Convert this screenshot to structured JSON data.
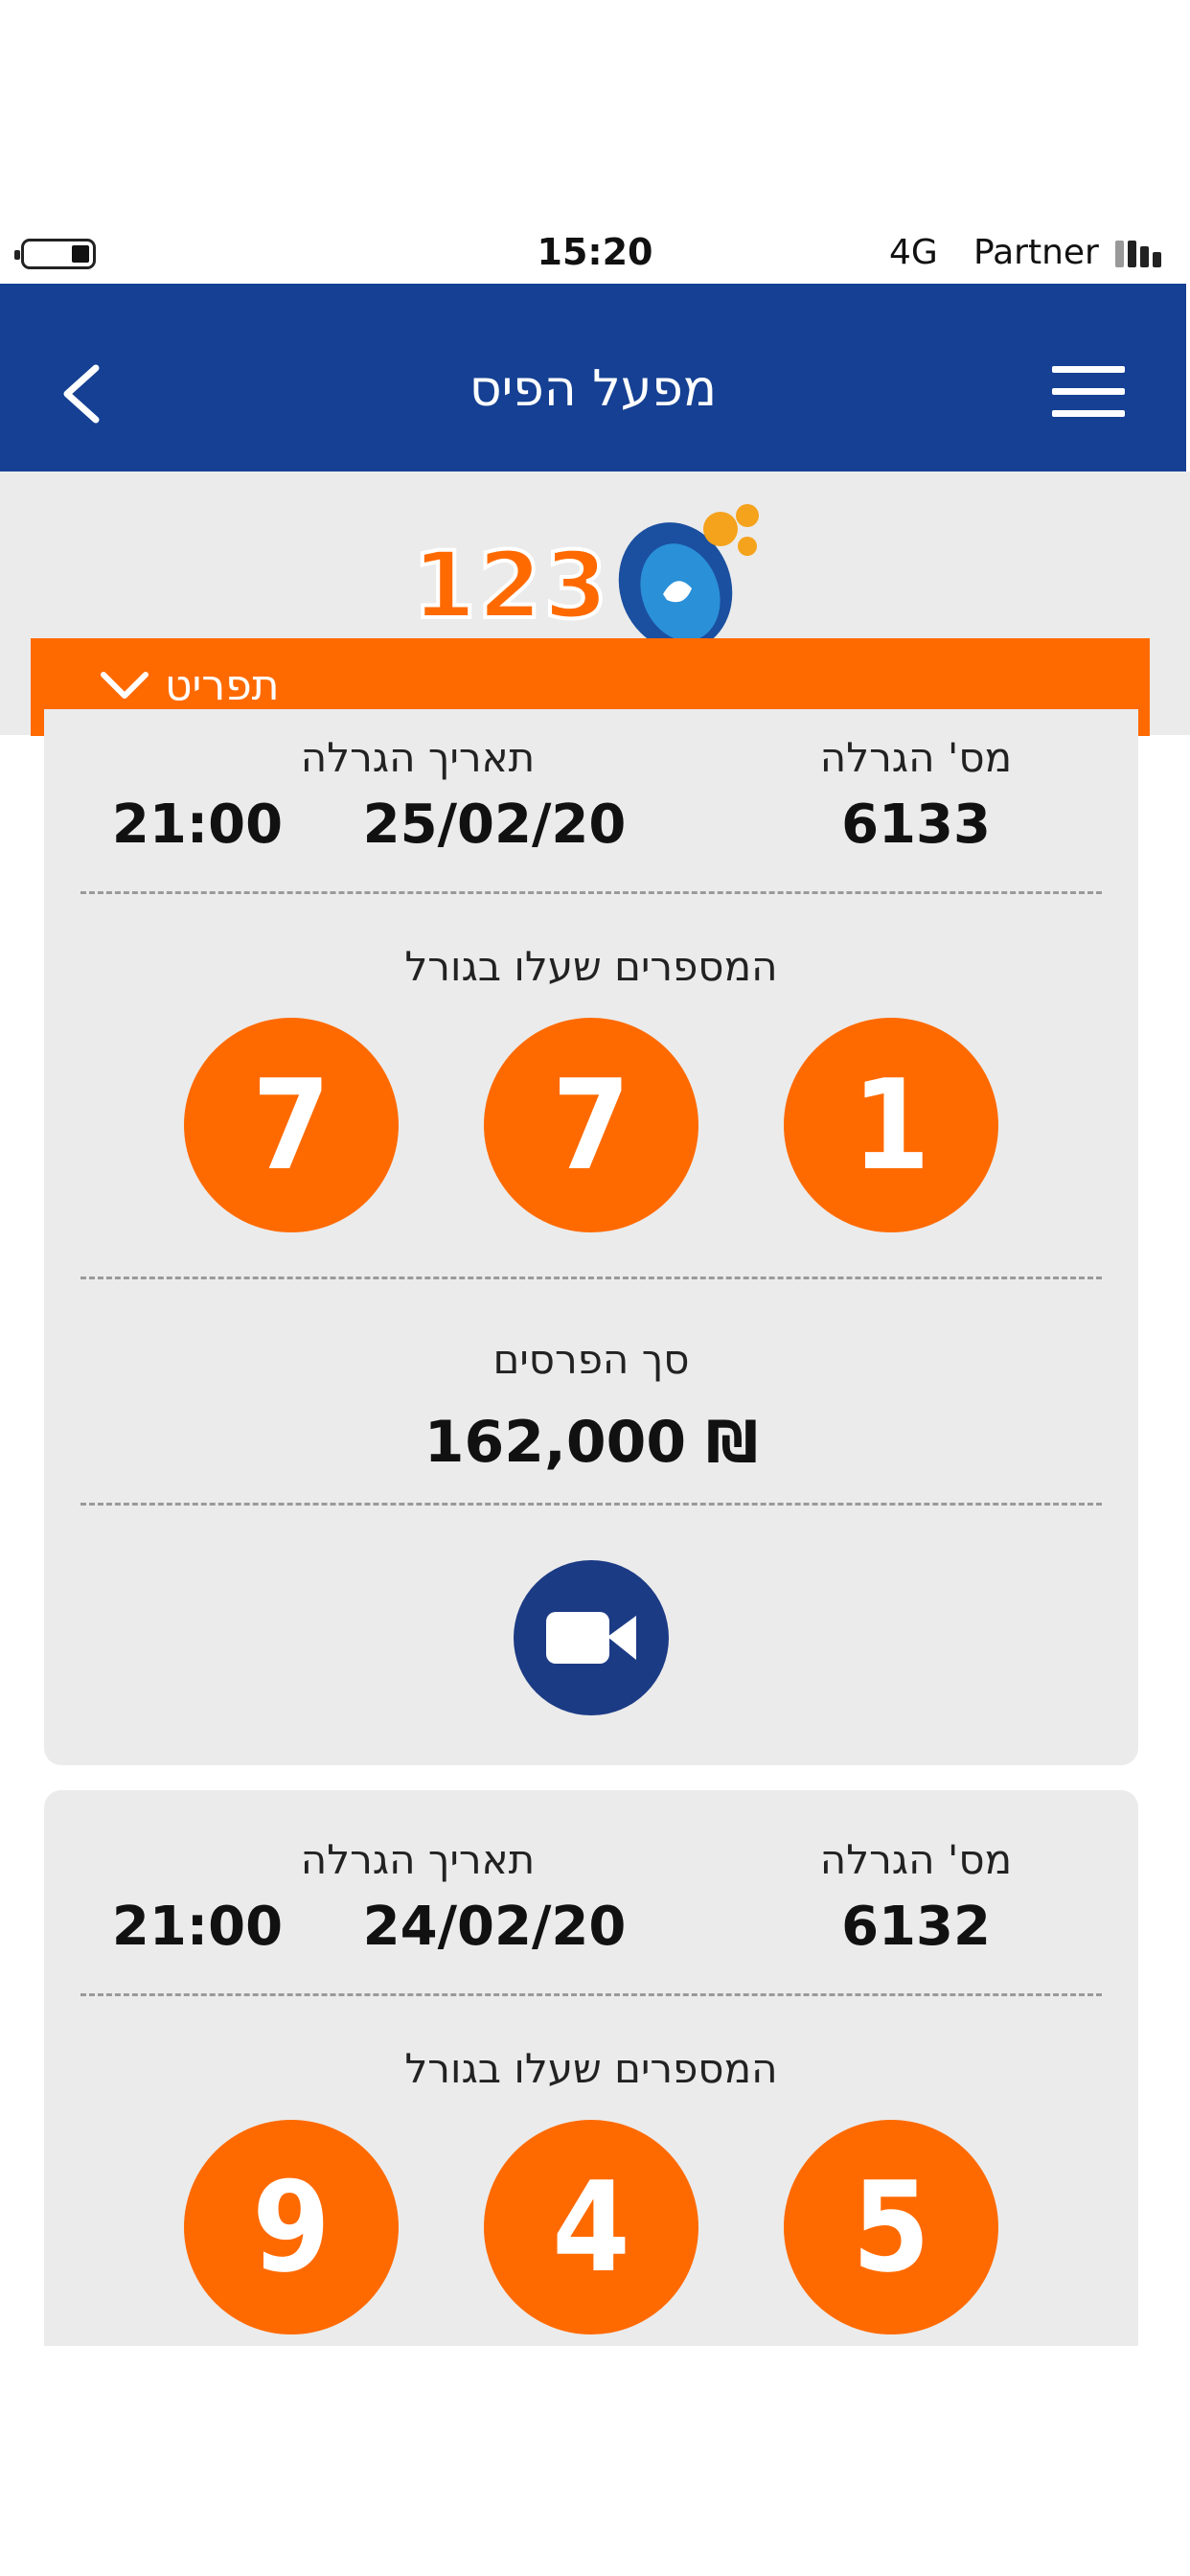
{
  "status": {
    "time": "15:20",
    "network": "4G",
    "carrier": "Partner"
  },
  "nav": {
    "title": "מפעל הפיס",
    "back_icon": "chevron-left-icon",
    "menu_icon": "hamburger-menu-icon"
  },
  "logo": {
    "text": "123",
    "icon": "pais-logo-icon"
  },
  "dropdown": {
    "label": "תפריט",
    "icon": "chevron-down-icon"
  },
  "labels": {
    "draw_number": "מס' הגרלה",
    "draw_date": "תאריך הגרלה",
    "winning_numbers": "המספרים שעלו בגורל",
    "total_prizes": "סך הפרסים"
  },
  "draws": [
    {
      "draw_number": "6133",
      "date": "25/02/20",
      "time": "21:00",
      "numbers": [
        "7",
        "7",
        "1"
      ],
      "prize_total": "162,000 ₪",
      "video_icon": "video-camera-icon"
    },
    {
      "draw_number": "6132",
      "date": "24/02/20",
      "time": "21:00",
      "numbers": [
        "9",
        "4",
        "5"
      ]
    }
  ],
  "colors": {
    "nav_blue": "#154093",
    "accent_orange": "#ff6a00",
    "card_gray": "#ebebeb",
    "video_blue": "#1c3b85"
  }
}
